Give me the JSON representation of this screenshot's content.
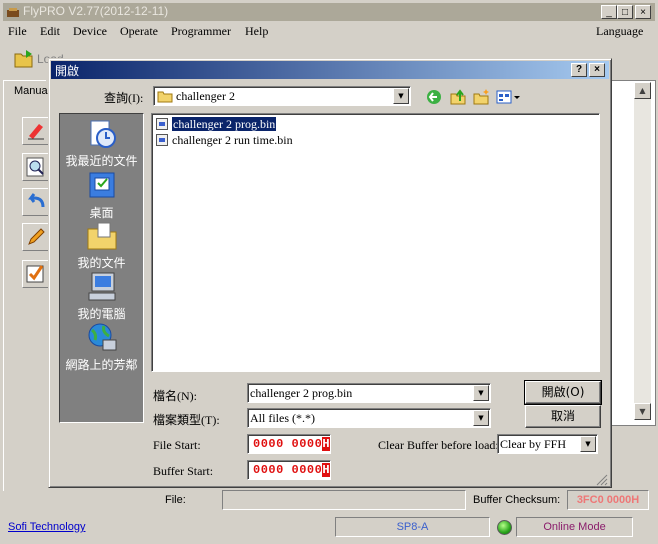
{
  "main_window": {
    "title": "FlyPRO V2.77(2012-12-11)",
    "menu": [
      {
        "label": "File"
      },
      {
        "label": "Edit"
      },
      {
        "label": "Device"
      },
      {
        "label": "Operate"
      },
      {
        "label": "Programmer"
      },
      {
        "label": "Help"
      }
    ],
    "menu_language": "Language",
    "toolbar": {
      "load_label": "Load"
    },
    "left_panel_tab": "Manual",
    "file_label": "File:",
    "file_value": "",
    "buffer_checksum_label": "Buffer Checksum:",
    "buffer_checksum_value": "3FC0 0000H",
    "status": {
      "company": "Sofi Technology",
      "programmer": "SP8-A",
      "mode": "Online Mode"
    }
  },
  "dialog": {
    "title": "開啟",
    "look_in_label": "查詢(I):",
    "look_in_value": "challenger 2",
    "places": [
      {
        "label": "我最近的文件",
        "icon": "recent-documents-icon"
      },
      {
        "label": "桌面",
        "icon": "desktop-icon"
      },
      {
        "label": "我的文件",
        "icon": "my-documents-icon"
      },
      {
        "label": "我的電腦",
        "icon": "my-computer-icon"
      },
      {
        "label": "網路上的芳鄰",
        "icon": "network-places-icon"
      }
    ],
    "files": [
      {
        "name": "challenger 2 prog.bin",
        "selected": true
      },
      {
        "name": "challenger 2 run time.bin",
        "selected": false
      }
    ],
    "filename_label": "檔名(N):",
    "filename_value": "challenger 2 prog.bin",
    "filetype_label": "檔案類型(T):",
    "filetype_value": "All files (*.*)",
    "open_button": "開啟(O)",
    "cancel_button": "取消",
    "file_start_label": "File Start:",
    "file_start_value": "0000 0000",
    "file_start_suffix": "H",
    "buffer_start_label": "Buffer Start:",
    "buffer_start_value": "0000 0000",
    "buffer_start_suffix": "H",
    "clear_buffer_label": "Clear Buffer before load:",
    "clear_buffer_value": "Clear by FFH"
  },
  "colors": {
    "dialog_title_start": "#0a246a",
    "dialog_title_end": "#a6caf0",
    "hex_text": "#e01010",
    "checksum_text": "#ee7777",
    "online_mode_text": "#8a1c6b",
    "link": "#0000cc"
  }
}
